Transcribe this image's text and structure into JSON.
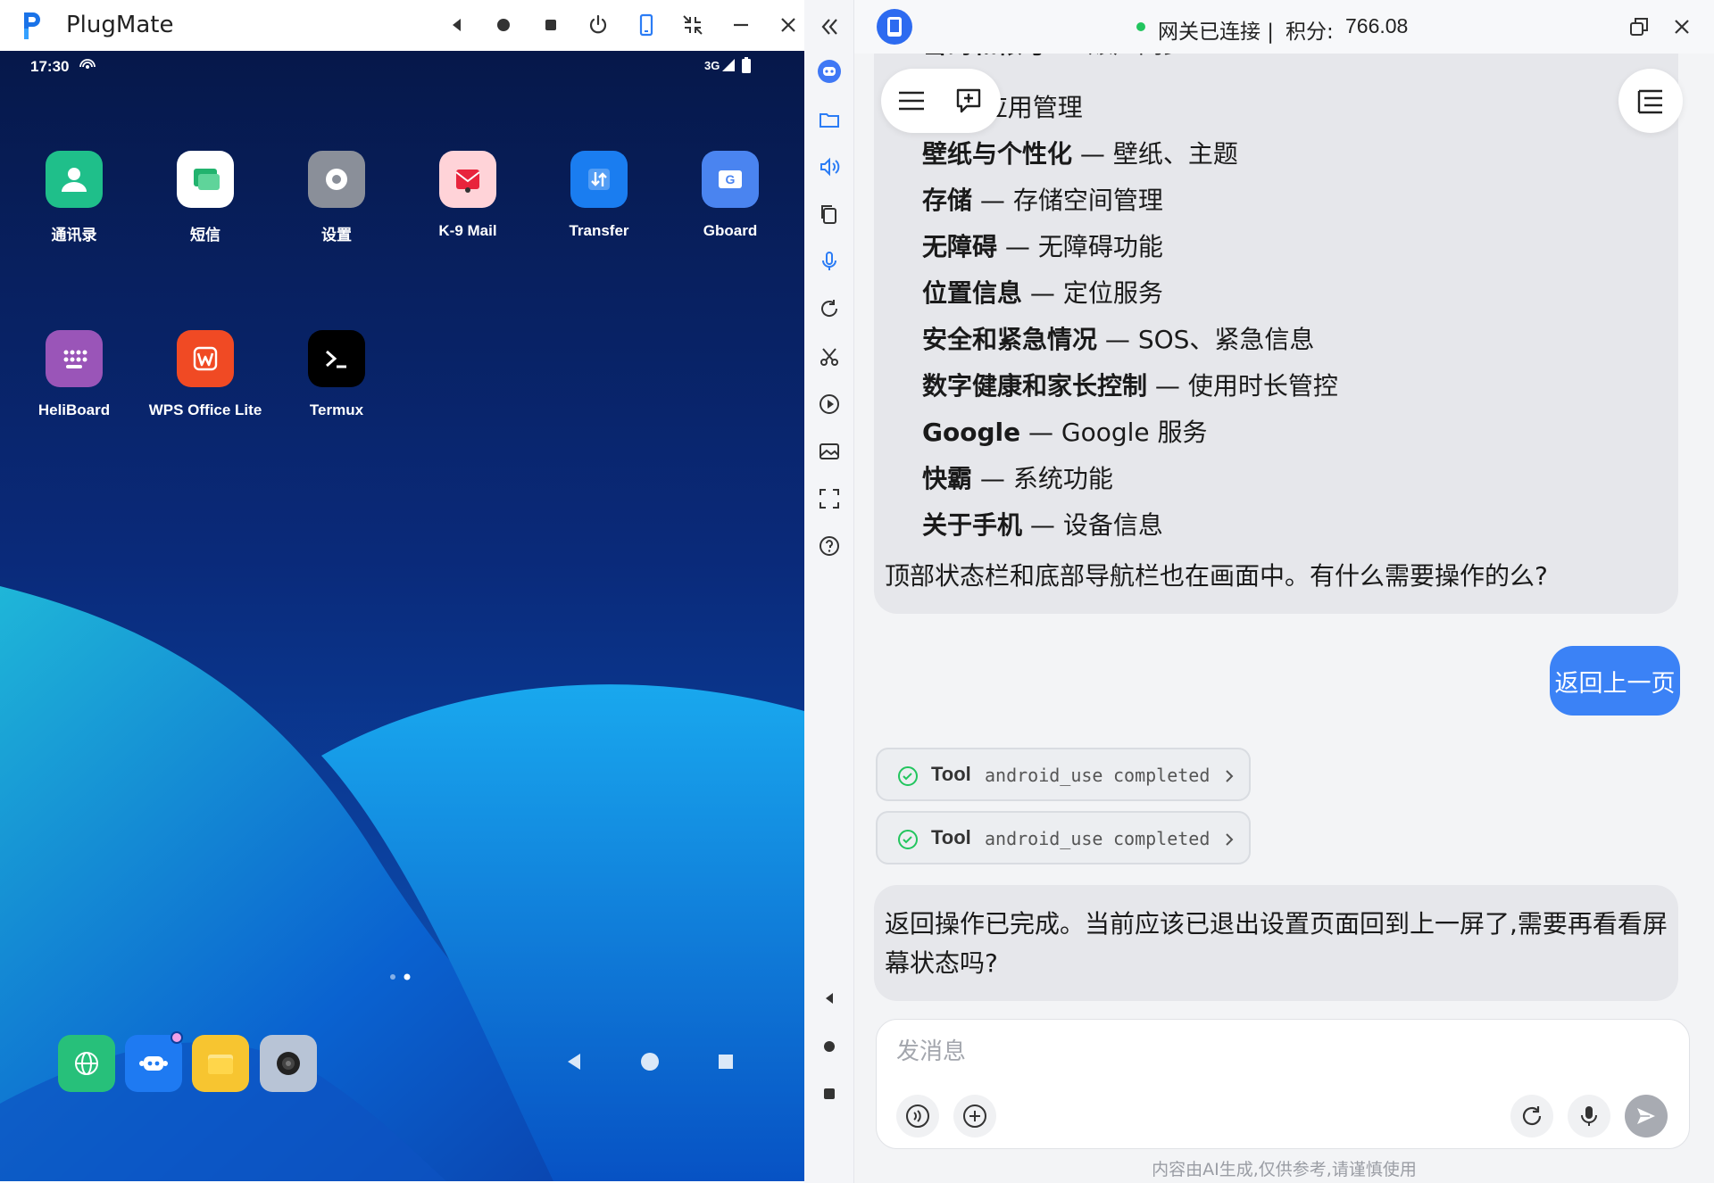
{
  "app": {
    "title": "PlugMate"
  },
  "phone": {
    "status": {
      "time": "17:30",
      "network": "3G"
    },
    "apps": [
      {
        "label": "通讯录",
        "icon": "contacts-icon",
        "color": "#1fbf8a"
      },
      {
        "label": "短信",
        "icon": "messages-icon",
        "color": "#ffffff"
      },
      {
        "label": "设置",
        "icon": "settings-icon",
        "color": "#8a8f99"
      },
      {
        "label": "K-9 Mail",
        "icon": "k9-mail-icon",
        "color": "#ffd3d8"
      },
      {
        "label": "Transfer",
        "icon": "transfer-icon",
        "color": "#1a7df0"
      },
      {
        "label": "Gboard",
        "icon": "gboard-icon",
        "color": "#4a84f0"
      },
      {
        "label": "HeliBoard",
        "icon": "heliboard-icon",
        "color": "#9a55b8"
      },
      {
        "label": "WPS Office Lite",
        "icon": "wps-icon",
        "color": "#f04a24"
      },
      {
        "label": "Termux",
        "icon": "termux-icon",
        "color": "#000000"
      }
    ],
    "dock": [
      "browser-icon",
      "robot-app-icon",
      "files-icon",
      "camera-icon"
    ]
  },
  "chat": {
    "connection_status": "网关已连接 |",
    "points_label": "积分:",
    "points_value": "766.08",
    "settings_list": [
      {
        "name": "密码和帐号",
        "desc": " — 账户同步"
      },
      {
        "name": "",
        "desc": "· 应用管理"
      },
      {
        "name": "壁纸与个性化",
        "desc": " — 壁纸、主题"
      },
      {
        "name": "存储",
        "desc": " — 存储空间管理"
      },
      {
        "name": "无障碍",
        "desc": " — 无障碍功能"
      },
      {
        "name": "位置信息",
        "desc": " — 定位服务"
      },
      {
        "name": "安全和紧急情况",
        "desc": " — SOS、紧急信息"
      },
      {
        "name": "数字健康和家长控制",
        "desc": " — 使用时长管控"
      },
      {
        "name": "Google",
        "desc": " — Google 服务"
      },
      {
        "name": "快霸",
        "desc": " — 系统功能"
      },
      {
        "name": "关于手机",
        "desc": " — 设备信息"
      }
    ],
    "assistant_footer": "顶部状态栏和底部导航栏也在画面中。有什么需要操作的么?",
    "user_message": "返回上一页",
    "tool_calls": [
      {
        "label": "Tool",
        "name": "android_use",
        "status": "completed"
      },
      {
        "label": "Tool",
        "name": "android_use",
        "status": "completed"
      }
    ],
    "assistant_reply": "返回操作已完成。当前应该已退出设置页面回到上一屏了,需要再看看屏幕状态吗?",
    "composer_placeholder": "发消息",
    "disclaimer": "内容由AI生成,仅供参考,请谨慎使用"
  },
  "colors": {
    "accent": "#3b82f6",
    "connected": "#22c55e"
  }
}
